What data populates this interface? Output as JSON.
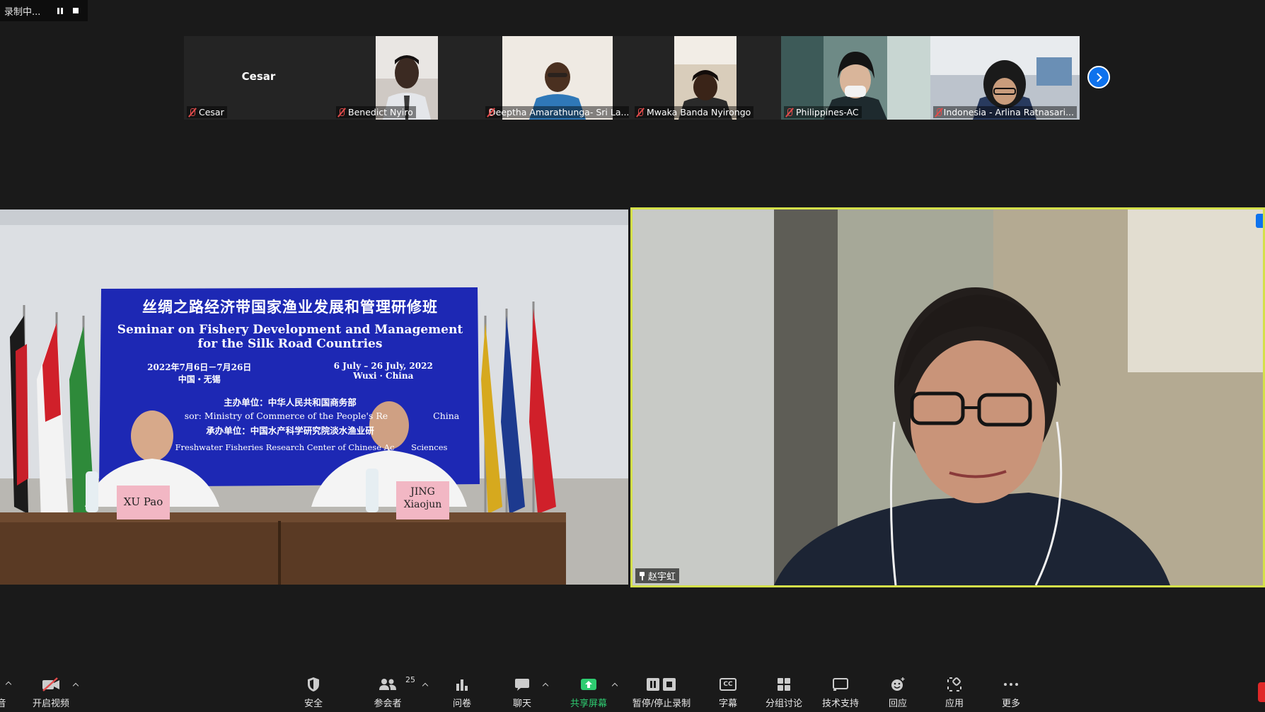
{
  "recording": {
    "status": "录制中..."
  },
  "strip": {
    "tiles": [
      {
        "name": "Cesar",
        "big_name": "Cesar"
      },
      {
        "name": "Benedict Nyiro"
      },
      {
        "name": "Deeptha Amarathunga- Sri La..."
      },
      {
        "name": "Mwaka Banda Nyirongo"
      },
      {
        "name": "Philippines-AC"
      },
      {
        "name": "Indonesia - Arlina Ratnasari..."
      }
    ]
  },
  "main_left": {
    "banner_cn": "丝绸之路经济带国家渔业发展和管理研修班",
    "banner_en1": "Seminar on Fishery Development and Management",
    "banner_en2": "for the Silk Road Countries",
    "date_cn": "2022年7月6日－7月26日",
    "place_cn": "中国・无锡",
    "date_en": "6 July – 26 July, 2022",
    "place_en": "Wuxi · China",
    "sponsor_cn": "主办单位：中华人民共和国商务部",
    "sponsor_en": "sor: Ministry of Commerce of the People's Re",
    "sponsor_en_tail": "China",
    "organizer_cn": "承办单位：中国水产科学研究院淡水渔业研",
    "organizer_en": "Freshwater Fisheries Research Center of Chinese Ac",
    "organizer_en_tail": "Sciences",
    "nameplate_1": "XU Pao",
    "nameplate_2a": "JING",
    "nameplate_2b": "Xiaojun"
  },
  "main_right": {
    "speaker_name": "赵宇虹"
  },
  "toolbar": {
    "video_label": "开启视频",
    "security_label": "安全",
    "participants_label": "参会者",
    "participants_count": "25",
    "polls_label": "问卷",
    "chat_label": "聊天",
    "share_label": "共享屏幕",
    "record_label": "暂停/停止录制",
    "captions_label": "字幕",
    "captions_icon_text": "CC",
    "breakout_label": "分组讨论",
    "support_label": "技术支持",
    "reactions_label": "回应",
    "apps_label": "应用",
    "more_label": "更多",
    "left_edge_label": "音"
  },
  "colors": {
    "accent": "#0e72ed",
    "active_speaker_border": "#d4e04a",
    "share_green": "#2ecc71",
    "mute_red": "#e24b4b"
  }
}
